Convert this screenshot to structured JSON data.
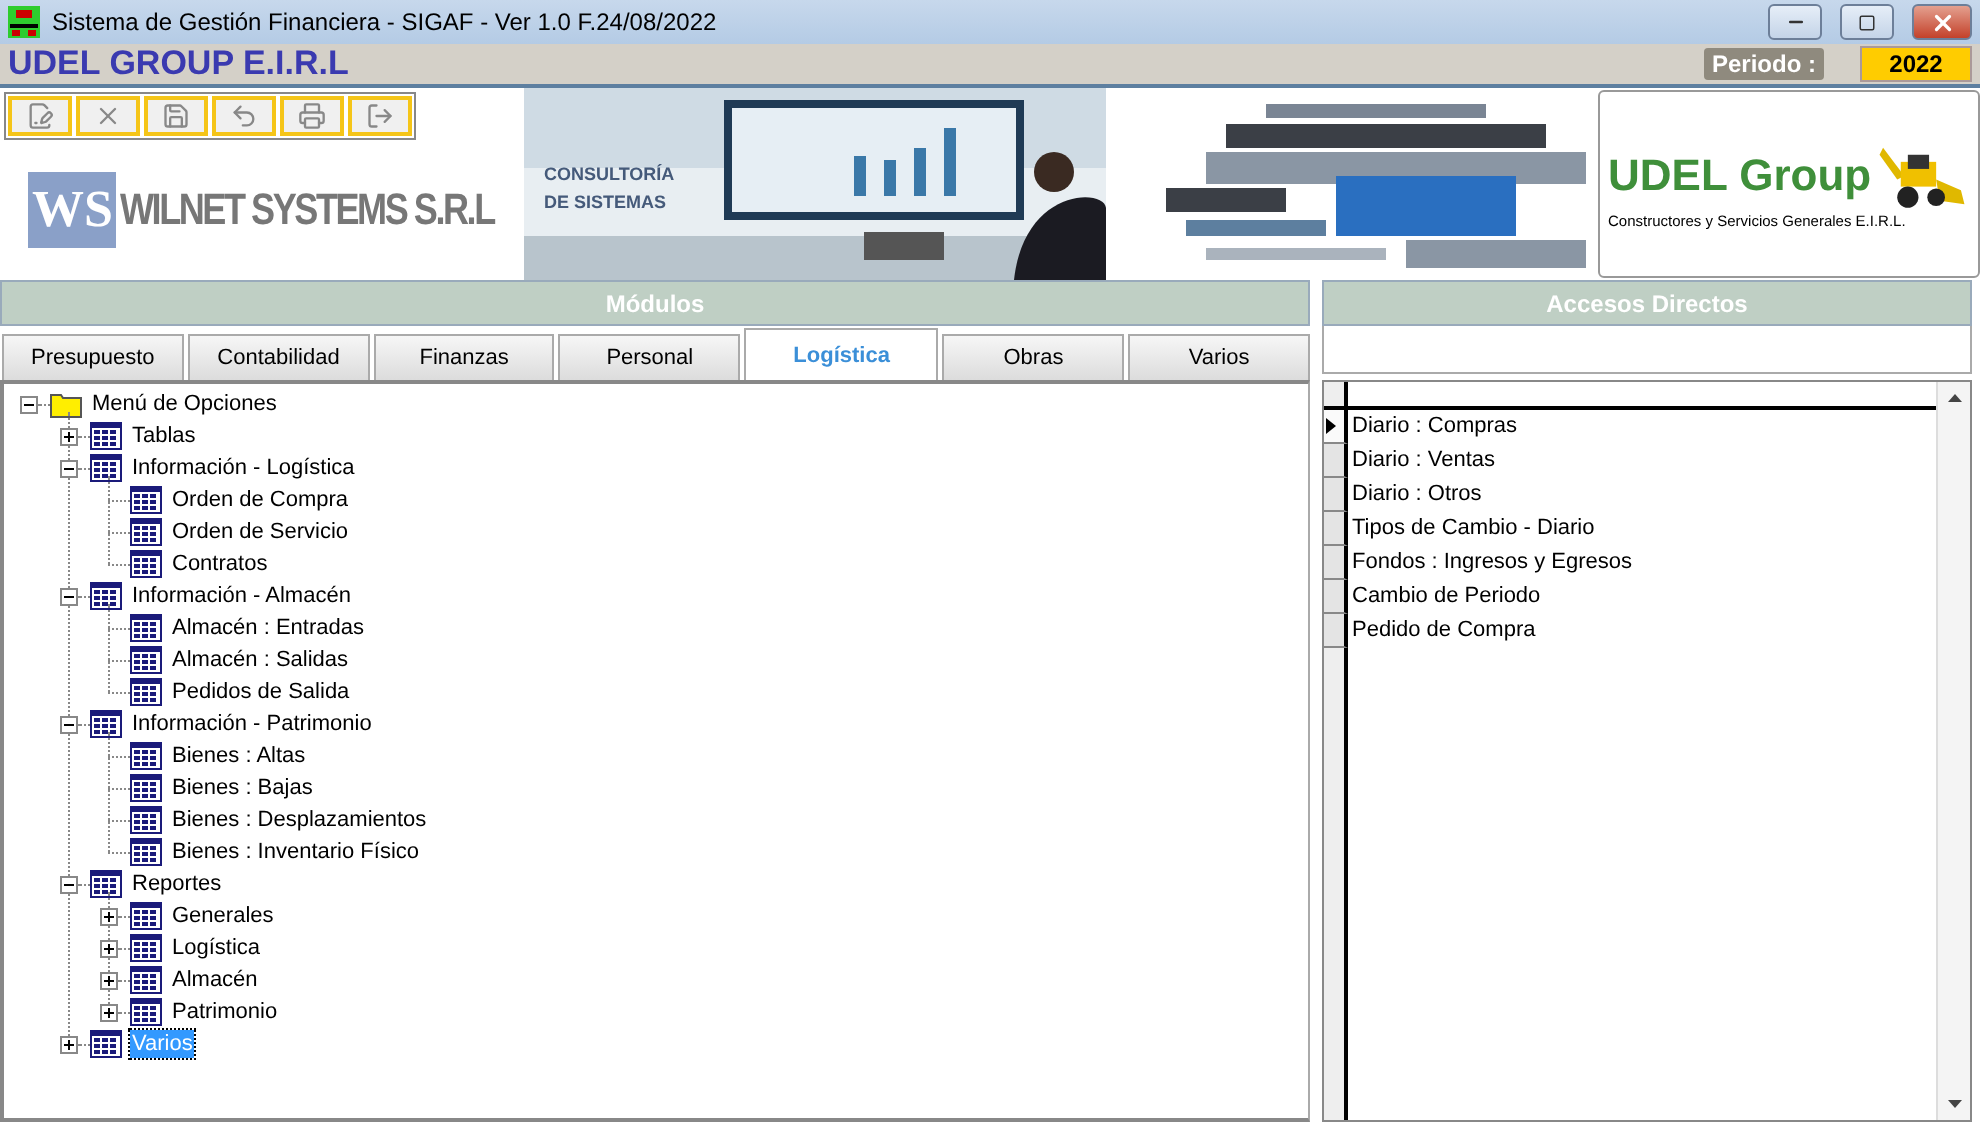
{
  "window": {
    "title": "Sistema de Gestión Financiera - SIGAF - Ver 1.0 F.24/08/2022"
  },
  "company": {
    "name": "UDEL GROUP E.I.R.L",
    "period_label": "Periodo :",
    "period": "2022"
  },
  "toolbar": [
    {
      "kind": "edit"
    },
    {
      "kind": "delete"
    },
    {
      "kind": "save"
    },
    {
      "kind": "undo"
    },
    {
      "kind": "print"
    },
    {
      "kind": "exit"
    }
  ],
  "banner": {
    "left_logo": {
      "mark": "WS",
      "text": "WILNET SYSTEMS S.R.L"
    },
    "caption": [
      "CONSULTORÍA",
      "DE SISTEMAS"
    ],
    "right_logo": {
      "title": "UDEL Group",
      "subtitle": "Constructores y Servicios Generales E.I.R.L."
    }
  },
  "modules": {
    "title": "Módulos",
    "tabs": [
      {
        "label": "Presupuesto",
        "selected": false
      },
      {
        "label": "Contabilidad",
        "selected": false
      },
      {
        "label": "Finanzas",
        "selected": false
      },
      {
        "label": "Personal",
        "selected": false
      },
      {
        "label": "Logística",
        "selected": true
      },
      {
        "label": "Obras",
        "selected": false
      },
      {
        "label": "Varios",
        "selected": false
      }
    ],
    "tree": [
      {
        "label": "Menú de Opciones",
        "kind": "folder",
        "expanded": true,
        "selected": false,
        "children": [
          {
            "label": "Tablas",
            "kind": "table",
            "expanded": false,
            "selected": false
          },
          {
            "label": "Información - Logística",
            "kind": "table",
            "expanded": true,
            "selected": false,
            "children": [
              {
                "label": "Orden de Compra",
                "kind": "table",
                "selected": false
              },
              {
                "label": "Orden de Servicio",
                "kind": "table",
                "selected": false
              },
              {
                "label": "Contratos",
                "kind": "table",
                "selected": false
              }
            ]
          },
          {
            "label": "Información - Almacén",
            "kind": "table",
            "expanded": true,
            "selected": false,
            "children": [
              {
                "label": "Almacén : Entradas",
                "kind": "table",
                "selected": false
              },
              {
                "label": "Almacén : Salidas",
                "kind": "table",
                "selected": false
              },
              {
                "label": "Pedidos de Salida",
                "kind": "table",
                "selected": false
              }
            ]
          },
          {
            "label": "Información - Patrimonio",
            "kind": "table",
            "expanded": true,
            "selected": false,
            "children": [
              {
                "label": "Bienes : Altas",
                "kind": "table",
                "selected": false
              },
              {
                "label": "Bienes : Bajas",
                "kind": "table",
                "selected": false
              },
              {
                "label": "Bienes : Desplazamientos",
                "kind": "table",
                "selected": false
              },
              {
                "label": "Bienes : Inventario Físico",
                "kind": "table",
                "selected": false
              }
            ]
          },
          {
            "label": "Reportes",
            "kind": "table",
            "expanded": true,
            "selected": false,
            "children": [
              {
                "label": "Generales",
                "kind": "table",
                "expanded": false,
                "selected": false
              },
              {
                "label": "Logística",
                "kind": "table",
                "expanded": false,
                "selected": false
              },
              {
                "label": "Almacén",
                "kind": "table",
                "expanded": false,
                "selected": false
              },
              {
                "label": "Patrimonio",
                "kind": "table",
                "expanded": false,
                "selected": false
              }
            ]
          },
          {
            "label": "Varios",
            "kind": "table",
            "expanded": false,
            "selected": true
          }
        ]
      }
    ]
  },
  "shortcuts": {
    "title": "Accesos Directos",
    "rows": [
      {
        "label": "Diario : Compras",
        "selected": true
      },
      {
        "label": "Diario : Ventas",
        "selected": false
      },
      {
        "label": "Diario : Otros",
        "selected": false
      },
      {
        "label": "Tipos de Cambio - Diario",
        "selected": false
      },
      {
        "label": "Fondos : Ingresos y Egresos",
        "selected": false
      },
      {
        "label": "Cambio de Periodo",
        "selected": false
      },
      {
        "label": "Pedido de Compra",
        "selected": false
      }
    ]
  }
}
